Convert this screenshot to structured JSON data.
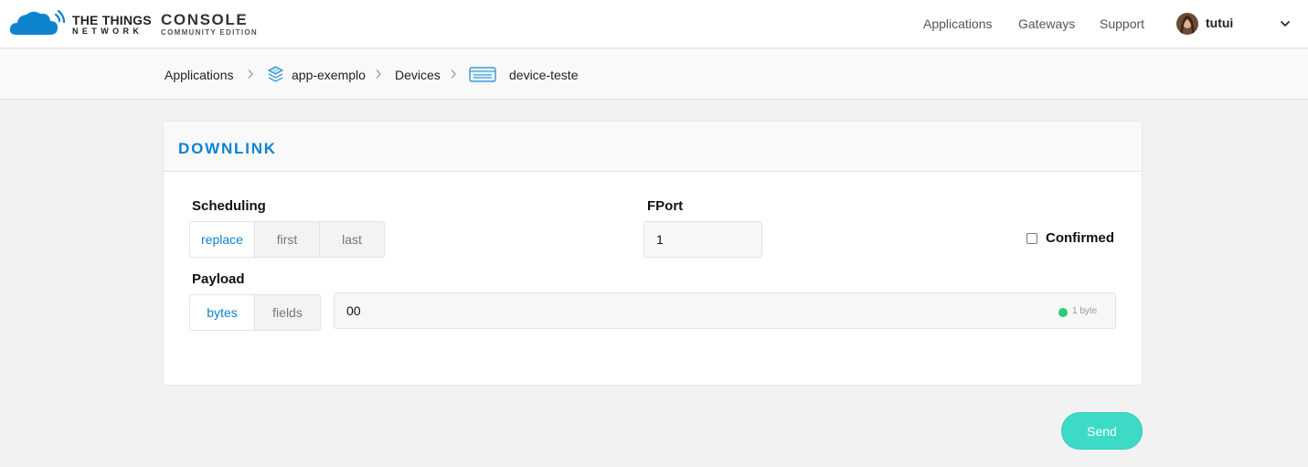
{
  "brand": {
    "line1": "THE THINGS",
    "line2": "NETWORK",
    "console": "CONSOLE",
    "edition": "COMMUNITY EDITION"
  },
  "nav": {
    "applications": "Applications",
    "gateways": "Gateways",
    "support": "Support",
    "username": "tutui"
  },
  "breadcrumb": {
    "applications": "Applications",
    "app": "app-exemplo",
    "devices": "Devices",
    "device": "device-teste"
  },
  "downlink": {
    "title": "DOWNLINK",
    "scheduling_label": "Scheduling",
    "scheduling_options": [
      "replace",
      "first",
      "last"
    ],
    "scheduling_selected": "replace",
    "fport_label": "FPort",
    "fport_value": "1",
    "confirmed_label": "Confirmed",
    "confirmed_checked": false,
    "payload_label": "Payload",
    "payload_options": [
      "bytes",
      "fields"
    ],
    "payload_selected": "bytes",
    "payload_value": "00",
    "payload_size": "1 byte",
    "send_label": "Send"
  },
  "colors": {
    "accent": "#0d83d0",
    "send": "#3ddbc6",
    "valid": "#2ecc71"
  }
}
